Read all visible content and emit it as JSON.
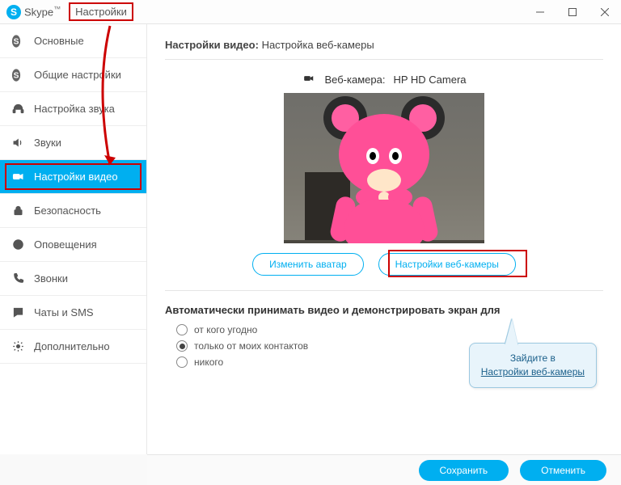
{
  "titlebar": {
    "app_name": "Skype",
    "menu_label": "Настройки"
  },
  "sidebar": {
    "items": [
      {
        "label": "Основные"
      },
      {
        "label": "Общие настройки"
      },
      {
        "label": "Настройка звука"
      },
      {
        "label": "Звуки"
      },
      {
        "label": "Настройки видео"
      },
      {
        "label": "Безопасность"
      },
      {
        "label": "Оповещения"
      },
      {
        "label": "Звонки"
      },
      {
        "label": "Чаты и SMS"
      },
      {
        "label": "Дополнительно"
      }
    ]
  },
  "content": {
    "heading_bold": "Настройки видео:",
    "heading_rest": "Настройка веб-камеры",
    "webcam_label": "Веб-камера:",
    "webcam_name": "HP HD Camera",
    "btn_avatar": "Изменить аватар",
    "btn_cam_settings": "Настройки веб-камеры",
    "auto_section": "Автоматически принимать видео и демонстрировать экран для",
    "radios": [
      {
        "label": "от кого угодно",
        "checked": false
      },
      {
        "label": "только от моих контактов",
        "checked": true
      },
      {
        "label": "никого",
        "checked": false
      }
    ]
  },
  "footer": {
    "save": "Сохранить",
    "cancel": "Отменить"
  },
  "callout": {
    "line1": "Зайдите в",
    "link": "Настройки веб-камеры"
  }
}
